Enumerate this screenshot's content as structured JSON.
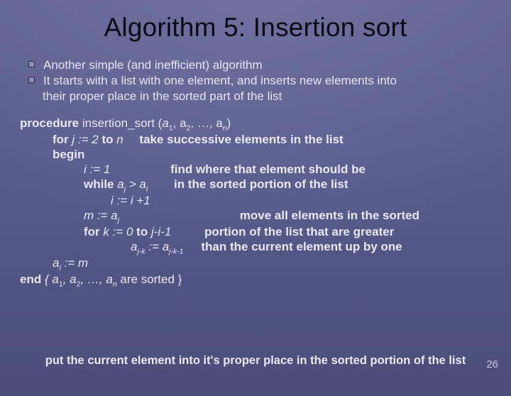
{
  "title": "Algorithm 5: Insertion sort",
  "bullets": {
    "b1": "Another simple (and inefficient) algorithm",
    "b2a": "It starts with a list with one element, and inserts new elements into",
    "b2b": "their proper place in the sorted part of the list"
  },
  "code": {
    "proc_kw": "procedure",
    "proc_name": " insertion_sort (",
    "proc_args_close": ")",
    "for_kw": "for",
    "for_body": " j := 2 ",
    "to_kw": "to",
    "for_body2": " n",
    "begin_kw": "begin",
    "i_init": "i := 1",
    "while_kw": "while",
    "while_pre": " a",
    "while_gt": " > a",
    "i_inc": "i := i +1",
    "m_line_pre": "m := a",
    "for2_kw": "for",
    "for2_body": " k := 0 ",
    "to2_kw": "to",
    "for2_body2": " j-i-1",
    "assign_a_pre": "a",
    "assign_eq": " := a",
    "ai_m_pre": "a",
    "ai_m_post": " := m",
    "end_kw": "end",
    "end_body": " { a",
    "end_tail": " are sorted }"
  },
  "subs": {
    "one": "1",
    "two": "2",
    "n": "n",
    "j": "j",
    "i": "i",
    "jk": "j-k",
    "jk1": "j-k-1"
  },
  "ann": {
    "take": "take successive elements in the list",
    "find": "find where that element should be",
    "sorted": "in the sorted portion of the list",
    "move1": "move all elements in the sorted",
    "move2": "portion of the list that are greater",
    "move3": "than the current element up by one"
  },
  "footnote": "put the current element into it's proper place in the sorted portion of the list",
  "pagenum": "26",
  "seq_sep1": ", a",
  "seq_sep2": ", …, a"
}
